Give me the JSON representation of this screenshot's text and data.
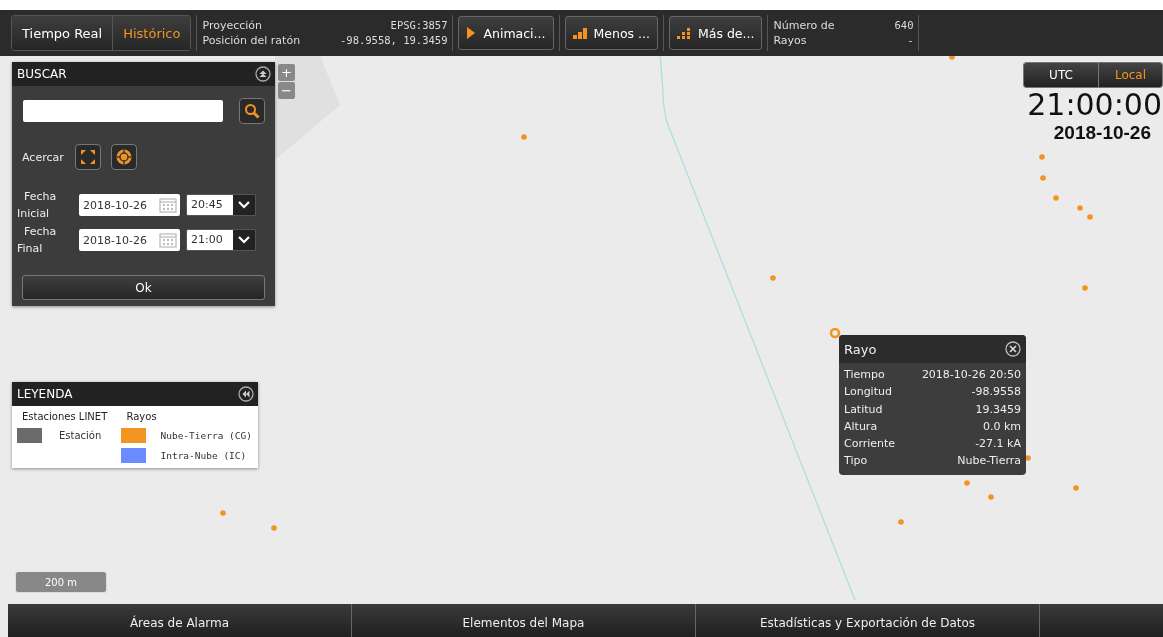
{
  "toolbar": {
    "modes": [
      {
        "label": "Tiempo Real",
        "selected": false
      },
      {
        "label": "Histórico",
        "selected": true
      }
    ],
    "info": [
      {
        "label": "Proyección",
        "value": "EPSG:3857"
      },
      {
        "label": "Posición del ratón",
        "value": "-98.9558, 19.3459"
      }
    ],
    "buttons": [
      {
        "kind": "play",
        "label": "Animaci..."
      },
      {
        "kind": "less",
        "label": "Menos ..."
      },
      {
        "kind": "more",
        "label": "Más de..."
      }
    ],
    "count": {
      "label_1": "Número de",
      "label_2": "Rayos",
      "value_1": "640",
      "value_2": "-"
    }
  },
  "zoom": {
    "plus": "+",
    "minus": "−"
  },
  "search": {
    "title": "BUSCAR",
    "zoom_label": "Acercar",
    "start": {
      "label_1": "Fecha",
      "label_2": "Inicial",
      "date": "2018-10-26",
      "time": "20:45"
    },
    "end": {
      "label_1": "Fecha",
      "label_2": "Final",
      "date": "2018-10-26",
      "time": "21:00"
    },
    "ok": "Ok"
  },
  "legend": {
    "title": "LEYENDA",
    "groups": [
      {
        "title": "Estaciones LINET",
        "items": [
          {
            "label": "Estación",
            "color": "#6b6b6b"
          }
        ]
      },
      {
        "title": "Rayos",
        "items": [
          {
            "label": "Nube-Tierra (CG)",
            "color": "#f39422"
          },
          {
            "label": "Intra-Nube (IC)",
            "color": "#6b8cff"
          }
        ]
      }
    ]
  },
  "scale": "200 m",
  "clock": {
    "zones": [
      {
        "label": "UTC",
        "selected": false
      },
      {
        "label": "Local",
        "selected": true
      }
    ],
    "time": "21:00:00",
    "date": "2018-10-26"
  },
  "popup": {
    "title": "Rayo",
    "rows": [
      {
        "label": "Tiempo",
        "value": "2018-10-26 20:50"
      },
      {
        "label": "Longitud",
        "value": "-98.9558"
      },
      {
        "label": "Latitud",
        "value": "19.3459"
      },
      {
        "label": "Altura",
        "value": "0.0 km"
      },
      {
        "label": "Corriente",
        "value": "-27.1 kA"
      },
      {
        "label": "Tipo",
        "value": "Nube-Tierra"
      }
    ]
  },
  "bottom_tabs": [
    "Áreas de Alarma",
    "Elementos del Mapa",
    "Estadísticas y Exportación de Datos"
  ]
}
